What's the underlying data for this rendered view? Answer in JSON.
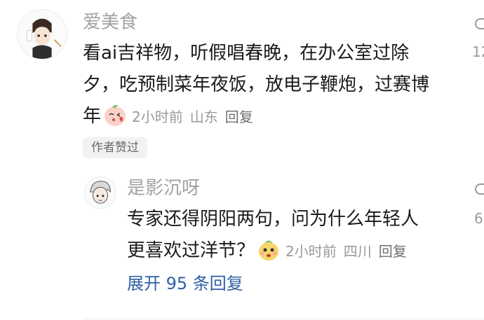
{
  "comment": {
    "username": "爱美食",
    "text_lines": [
      "看ai吉祥物，听假唱春晚，在办公室过除",
      "夕，吃预制菜年夜饭，放电子鞭炮，过赛博",
      "年"
    ],
    "time": "2小时前",
    "location": "山东",
    "reply_label": "回复",
    "badge": "作者赞过",
    "like_count_partial": "12",
    "emoji": "peach-kiss-emoji-icon"
  },
  "reply": {
    "username": "是影沉呀",
    "text_lines": [
      "专家还得阴阳两句，问为什么年轻人",
      "更喜欢过洋节？"
    ],
    "time": "2小时前",
    "location": "四川",
    "reply_label": "回复",
    "like_count_partial": "6",
    "emoji": "peach-face-emoji-icon"
  },
  "expand_label": "展开 95 条回复",
  "colors": {
    "username": "#a2a2a2",
    "body": "#1a1a1a",
    "meta": "#9a9a9a",
    "link": "#2d5fa6",
    "badge_bg": "#f2f2f2"
  }
}
